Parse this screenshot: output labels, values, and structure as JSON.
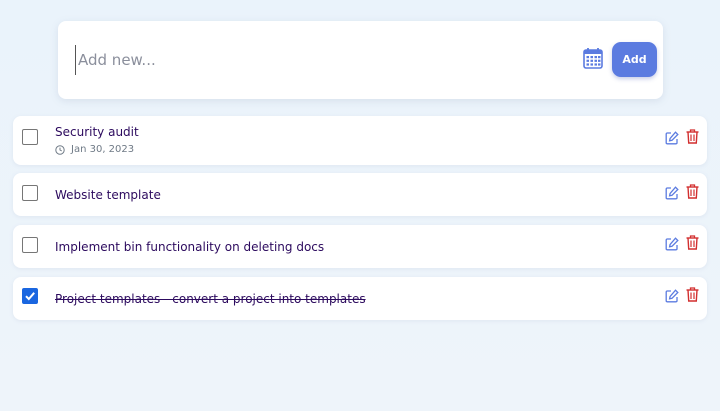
{
  "add_form": {
    "placeholder": "Add new...",
    "button_label": "Add",
    "calendar_icon": "calendar-icon"
  },
  "colors": {
    "accent": "#5b7be0",
    "title": "#2c0a5e",
    "delete": "#d22f2f",
    "edit": "#5b7be0",
    "checkbox_checked": "#1a66e0"
  },
  "todos": [
    {
      "title": "Security audit",
      "date": "Jan 30, 2023",
      "checked": false
    },
    {
      "title": "Website template",
      "date": "",
      "checked": false
    },
    {
      "title": "Implement bin functionality on deleting docs",
      "date": "",
      "checked": false
    },
    {
      "title": "Project templates - convert a project into templates",
      "date": "",
      "checked": true
    }
  ]
}
